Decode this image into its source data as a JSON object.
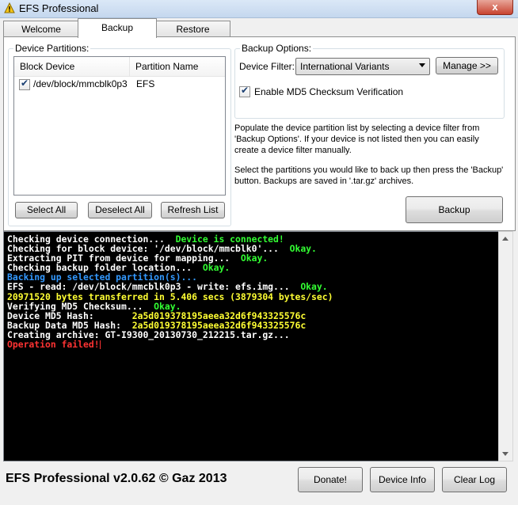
{
  "window": {
    "title": "EFS Professional",
    "close_label": "x"
  },
  "tabs": [
    {
      "label": "Welcome"
    },
    {
      "label": "Backup"
    },
    {
      "label": "Restore"
    }
  ],
  "partitions": {
    "group_label": "Device Partitions:",
    "columns": {
      "block_device": "Block Device",
      "partition_name": "Partition Name"
    },
    "rows": [
      {
        "checked": true,
        "block_device": "/dev/block/mmcblk0p3",
        "partition_name": "EFS"
      }
    ],
    "select_all": "Select All",
    "deselect_all": "Deselect All",
    "refresh_list": "Refresh List"
  },
  "backup_options": {
    "group_label": "Backup Options:",
    "filter_label": "Device Filter:",
    "filter_value": "International Variants",
    "manage_button": "Manage >>",
    "md5_label": "Enable MD5 Checksum Verification",
    "md5_checked": true
  },
  "info": {
    "text1": "Populate the device partition list by selecting a device filter from 'Backup Options'. If your device is not listed then you can easily create a device filter manually.",
    "text2": "Select the partitions you would like to back up then press the 'Backup' button. Backups are saved in '.tar.gz' archives."
  },
  "backup_button": "Backup",
  "console": {
    "colors": {
      "white": "#ffffff",
      "green": "#33ff33",
      "yellow": "#ffff33",
      "blue": "#3399ff",
      "red": "#ff3333"
    },
    "lines": [
      [
        {
          "text": "Checking device connection...  ",
          "color": "white"
        },
        {
          "text": "Device is connected!",
          "color": "green"
        }
      ],
      [
        {
          "text": "Checking for block device: '/dev/block/mmcblk0'...  ",
          "color": "white"
        },
        {
          "text": "Okay.",
          "color": "green"
        }
      ],
      [
        {
          "text": "Extracting PIT from device for mapping...  ",
          "color": "white"
        },
        {
          "text": "Okay.",
          "color": "green"
        }
      ],
      [
        {
          "text": "Checking backup folder location...  ",
          "color": "white"
        },
        {
          "text": "Okay.",
          "color": "green"
        }
      ],
      [
        {
          "text": "Backing up selected partition(s)...",
          "color": "blue"
        }
      ],
      [
        {
          "text": "EFS - read: /dev/block/mmcblk0p3 - write: efs.img...  ",
          "color": "white"
        },
        {
          "text": "Okay.",
          "color": "green"
        }
      ],
      [
        {
          "text": "20971520 bytes transferred in 5.406 secs (3879304 bytes/sec)",
          "color": "yellow"
        }
      ],
      [
        {
          "text": "Verifying MD5 Checksum...  ",
          "color": "white"
        },
        {
          "text": "Okay.",
          "color": "green"
        }
      ],
      [
        {
          "text": "Device MD5 Hash:       ",
          "color": "white"
        },
        {
          "text": "2a5d019378195aeea32d6f943325576c",
          "color": "yellow"
        }
      ],
      [
        {
          "text": "Backup Data MD5 Hash:  ",
          "color": "white"
        },
        {
          "text": "2a5d019378195aeea32d6f943325576c",
          "color": "yellow"
        }
      ],
      [
        {
          "text": "Creating archive: GT-I9300_20130730_212215.tar.gz...",
          "color": "white"
        }
      ],
      [
        {
          "text": "Operation failed!",
          "color": "red"
        }
      ]
    ]
  },
  "footer": {
    "app_title": "EFS Professional v2.0.62 © Gaz 2013",
    "donate": "Donate!",
    "device_info": "Device Info",
    "clear_log": "Clear Log"
  }
}
